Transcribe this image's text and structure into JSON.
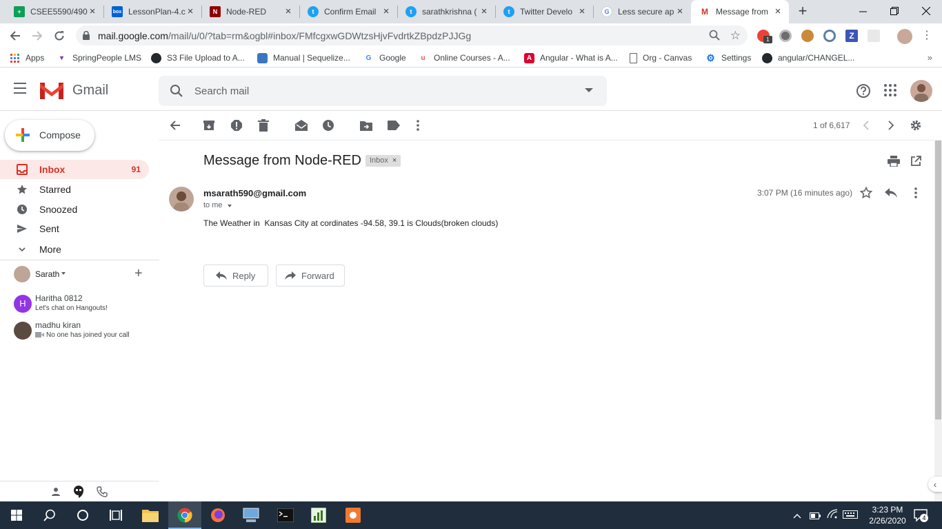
{
  "browser": {
    "tabs": [
      {
        "title": "CSEE5590/490",
        "favicon_color": "#0f9d58",
        "favicon_char": "+"
      },
      {
        "title": "LessonPlan-4.c",
        "favicon_color": "#0061d5",
        "favicon_char": "box"
      },
      {
        "title": "Node-RED",
        "favicon_color": "#8f0000",
        "favicon_char": "N"
      },
      {
        "title": "Confirm Email",
        "favicon_color": "#1da1f2",
        "favicon_char": "t"
      },
      {
        "title": "sarathkrishna (",
        "favicon_color": "#1da1f2",
        "favicon_char": "t"
      },
      {
        "title": "Twitter Develo",
        "favicon_color": "#1da1f2",
        "favicon_char": "t"
      },
      {
        "title": "Less secure ap",
        "favicon_color": "#4285f4",
        "favicon_char": "G"
      },
      {
        "title": "Message from",
        "favicon_color": "#d93025",
        "favicon_char": "M"
      }
    ],
    "url_host": "mail.google.com",
    "url_path": "/mail/u/0/?tab=rm&ogbl#inbox/FMfcgxwGDWtzsHjvFvdrtkZBpdzPJJGg",
    "extension_badge": "1",
    "bookmarks": [
      {
        "label": "Apps",
        "icon": "apps-icon"
      },
      {
        "label": "SpringPeople LMS",
        "icon": "springpeople-icon"
      },
      {
        "label": "S3 File Upload to A...",
        "icon": "github-icon"
      },
      {
        "label": "Manual | Sequelize...",
        "icon": "sequelize-icon"
      },
      {
        "label": "Google",
        "icon": "google-icon"
      },
      {
        "label": "Online Courses - A...",
        "icon": "udemy-icon"
      },
      {
        "label": "Angular - What is A...",
        "icon": "angular-icon"
      },
      {
        "label": "Org - Canvas",
        "icon": "document-icon"
      },
      {
        "label": "Settings",
        "icon": "gear-icon"
      },
      {
        "label": "angular/CHANGEL...",
        "icon": "github-icon"
      }
    ]
  },
  "gmail": {
    "brand": "Gmail",
    "search_placeholder": "Search mail",
    "compose_label": "Compose",
    "nav": [
      {
        "label": "Inbox",
        "count": "91",
        "icon": "inbox-icon"
      },
      {
        "label": "Starred",
        "count": "",
        "icon": "star-icon"
      },
      {
        "label": "Snoozed",
        "count": "",
        "icon": "clock-icon"
      },
      {
        "label": "Sent",
        "count": "",
        "icon": "send-icon"
      },
      {
        "label": "More",
        "count": "",
        "icon": "chevron-down-icon"
      }
    ],
    "hangouts": {
      "user": "Sarath",
      "contacts": [
        {
          "name": "Haritha 0812",
          "status": "Let's chat on Hangouts!",
          "initial": "H",
          "color": "#9334e6"
        },
        {
          "name": "madhu kiran",
          "status": "No one has joined your call",
          "initial": "",
          "color": "#5b4a3f"
        }
      ]
    },
    "pagination": "1 of 6,617",
    "message": {
      "subject": "Message from Node-RED",
      "label": "Inbox",
      "sender": "msarath590@gmail.com",
      "to": "to me",
      "time": "3:07 PM (16 minutes ago)",
      "body": "The Weather in  Kansas City at cordinates -94.58, 39.1 is Clouds(broken clouds)",
      "reply_label": "Reply",
      "forward_label": "Forward"
    }
  },
  "taskbar": {
    "time": "3:23 PM",
    "date": "2/26/2020",
    "notifications": "4"
  }
}
